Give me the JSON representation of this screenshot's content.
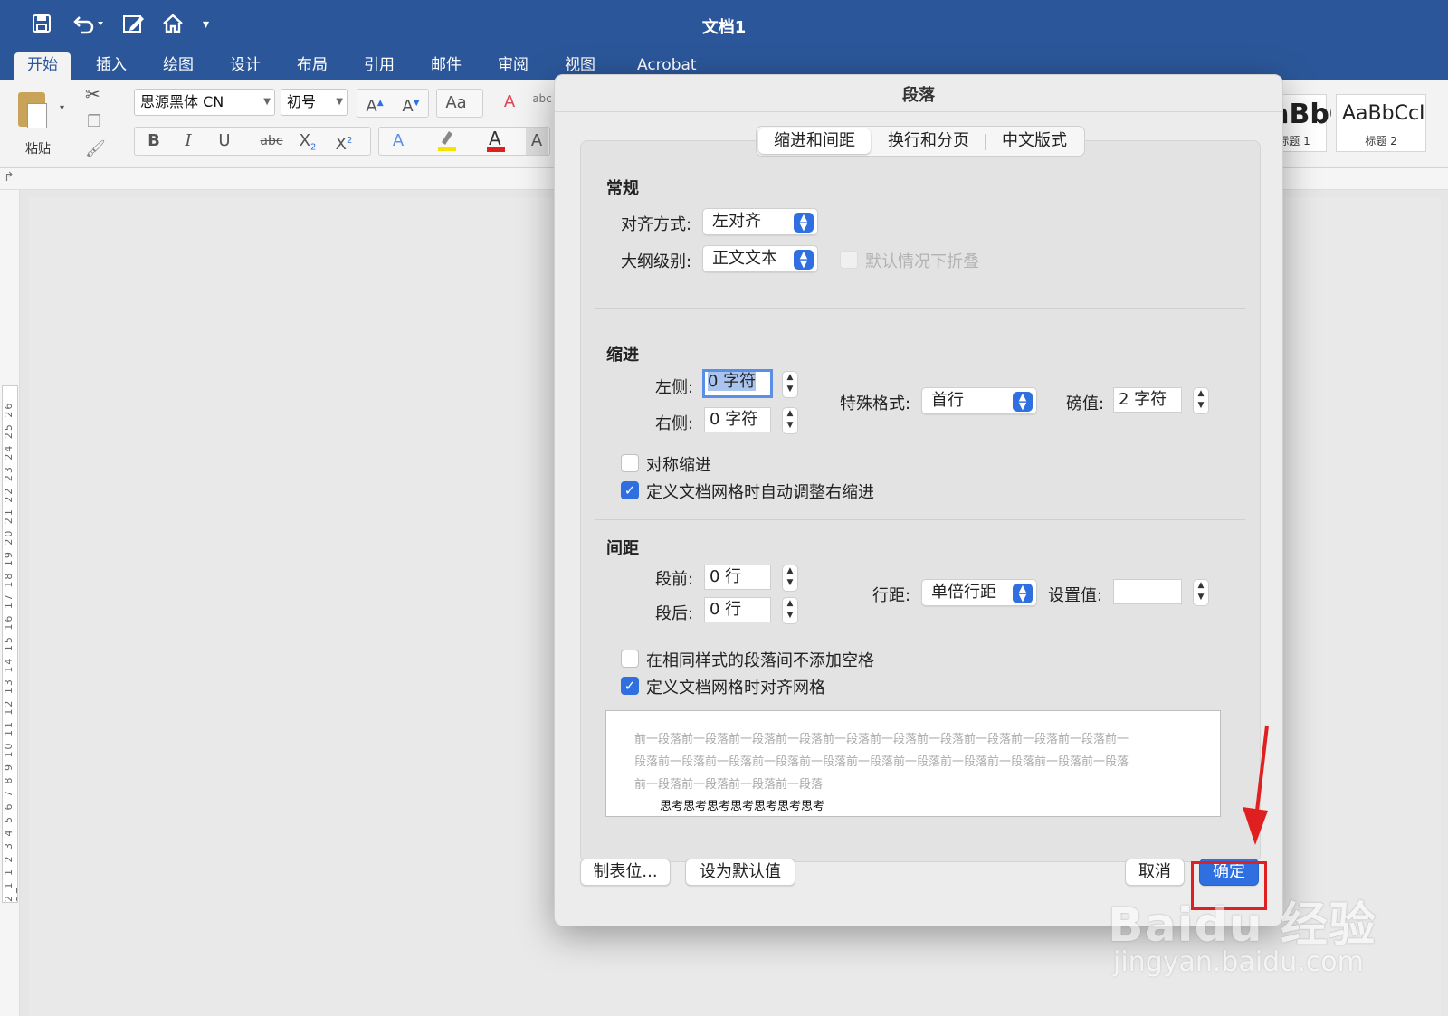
{
  "app": {
    "document_title": "文档1"
  },
  "quick_access": {
    "icons": [
      "save-icon",
      "undo-icon",
      "edit-icon",
      "home-icon",
      "customize-icon"
    ]
  },
  "ribbon_tabs": [
    "开始",
    "插入",
    "绘图",
    "设计",
    "布局",
    "引用",
    "邮件",
    "审阅",
    "视图",
    "Acrobat"
  ],
  "ribbon": {
    "paste_label": "粘贴",
    "font_name": "思源黑体 CN",
    "font_size": "初号",
    "styles": [
      {
        "sample": "AaBbC",
        "name": "标题 1"
      },
      {
        "sample": "AaBbCcI",
        "name": "标题 2"
      }
    ]
  },
  "left_ruler_marks": "2 1 1 2 3 4 5 6 7 8 9 10 11 12 13 14 15 16 17 18 19 20 21 22 23 24 25 26 27",
  "dialog": {
    "title": "段落",
    "tabs": [
      "缩进和间距",
      "换行和分页",
      "中文版式"
    ],
    "general": {
      "title": "常规",
      "alignment_label": "对齐方式:",
      "alignment_value": "左对齐",
      "outline_label": "大纲级别:",
      "outline_value": "正文文本",
      "collapse_label": "默认情况下折叠"
    },
    "indent": {
      "title": "缩进",
      "left_label": "左侧:",
      "left_value": "0 字符",
      "right_label": "右侧:",
      "right_value": "0 字符",
      "special_label": "特殊格式:",
      "special_value": "首行",
      "by_label": "磅值:",
      "by_value": "2 字符",
      "mirror_label": "对称缩进",
      "auto_adjust_label": "定义文档网格时自动调整右缩进"
    },
    "spacing": {
      "title": "间距",
      "before_label": "段前:",
      "before_value": "0 行",
      "after_label": "段后:",
      "after_value": "0 行",
      "line_label": "行距:",
      "line_value": "单倍行距",
      "at_label": "设置值:",
      "at_value": "",
      "no_space_label": "在相同样式的段落间不添加空格",
      "snap_grid_label": "定义文档网格时对齐网格"
    },
    "preview": {
      "lines": [
        "前一段落前一段落前一段落前一段落前一段落前一段落前一段落前一段落前一段落前一段落前一",
        "段落前一段落前一段落前一段落前一段落前一段落前一段落前一段落前一段落前一段落前一段落",
        "前一段落前一段落前一段落前一段落"
      ],
      "sample": "思考思考思考思考思考思考思考"
    },
    "buttons": {
      "tabs": "制表位...",
      "set_default": "设为默认值",
      "cancel": "取消",
      "ok": "确定"
    }
  },
  "watermark": {
    "text": "Baidu 经验",
    "url": "jingyan.baidu.com"
  },
  "colors": {
    "ribbon_blue": "#2b579a",
    "accent": "#2f6fe0",
    "highlight_red": "#e02020"
  }
}
